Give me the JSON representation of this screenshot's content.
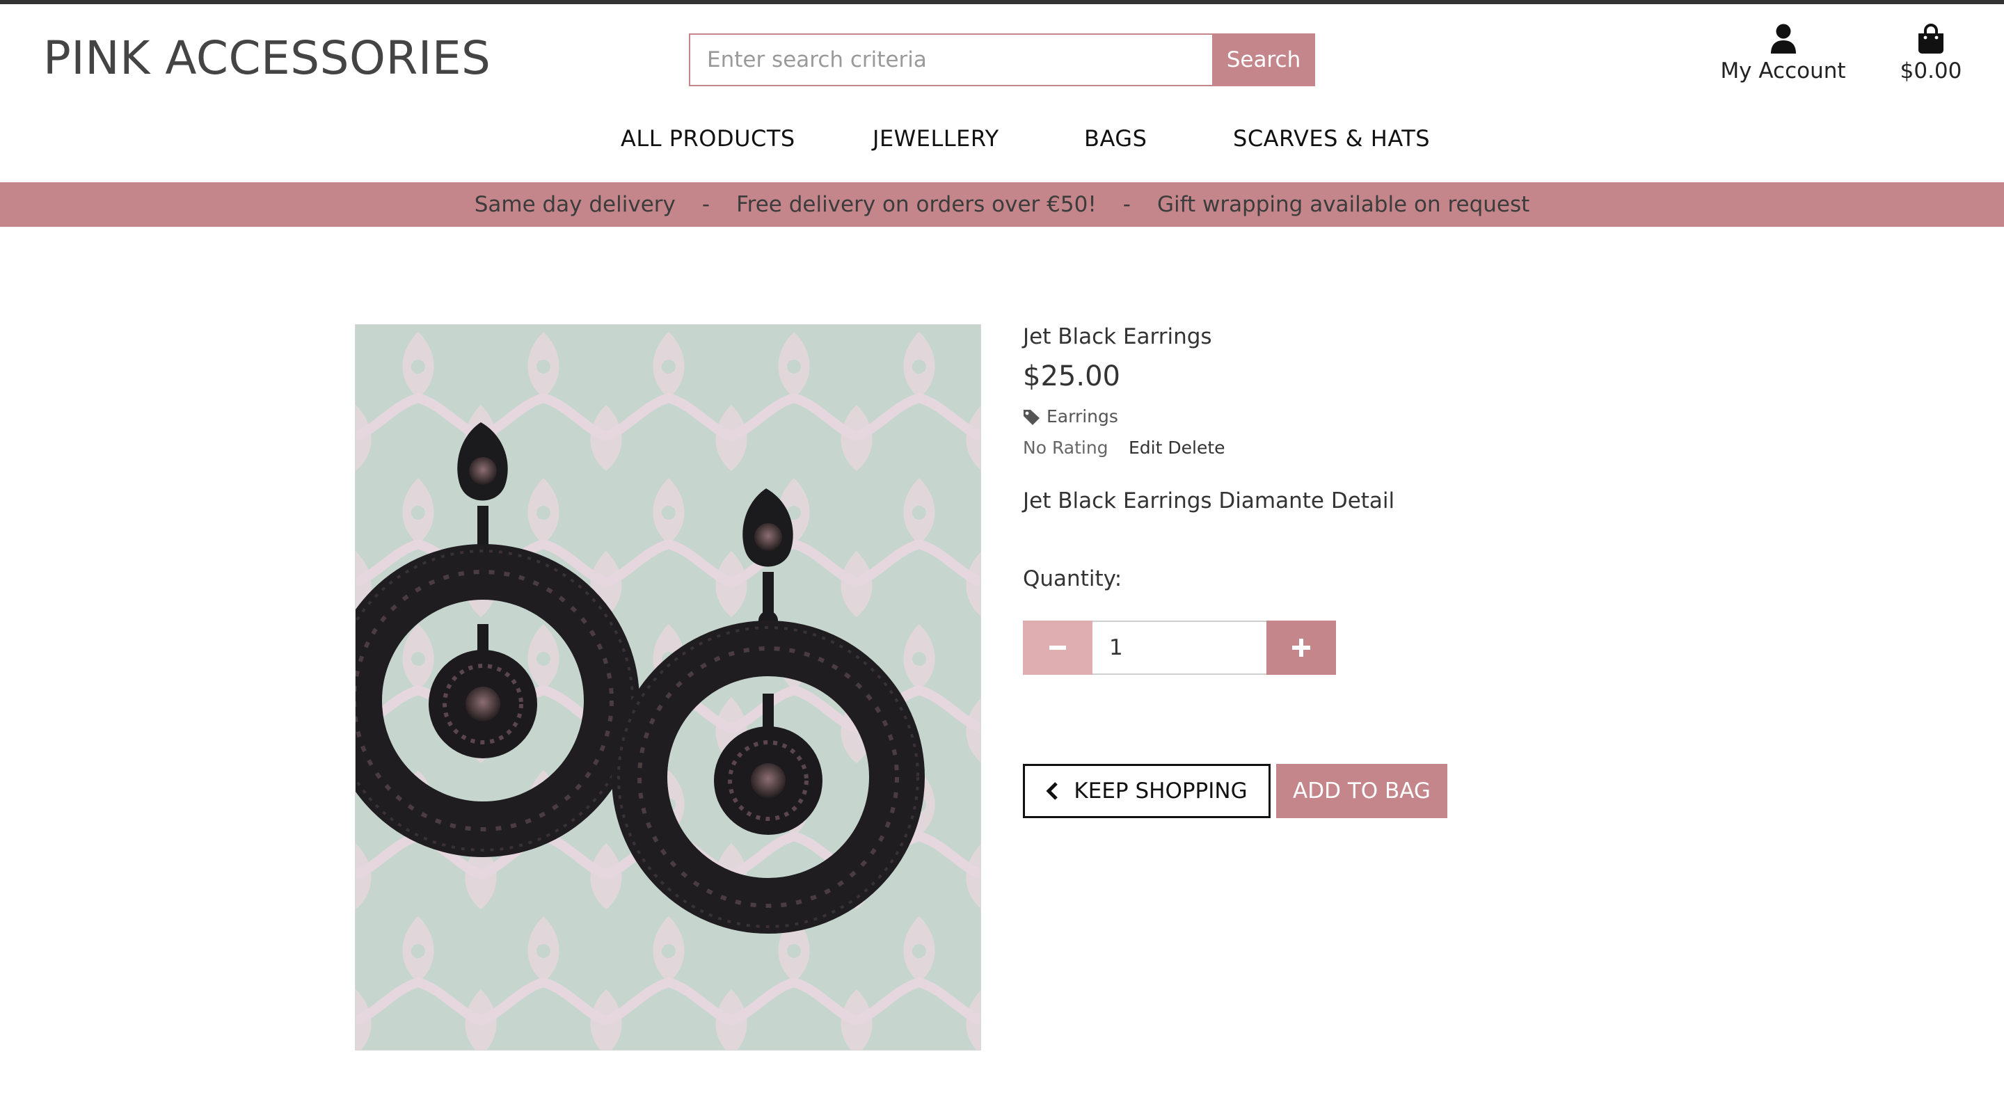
{
  "header": {
    "logo": "PINK ACCESSORIES",
    "search": {
      "placeholder": "Enter search criteria",
      "value": "",
      "button_label": "Search"
    },
    "account": {
      "label": "My Account",
      "icon": "user-icon"
    },
    "bag": {
      "total": "$0.00",
      "icon": "shopping-bag-icon"
    }
  },
  "nav": {
    "items": [
      {
        "label": "ALL PRODUCTS"
      },
      {
        "label": "JEWELLERY"
      },
      {
        "label": "BAGS"
      },
      {
        "label": "SCARVES & HATS"
      }
    ]
  },
  "banner": {
    "messages": [
      "Same day delivery",
      "Free delivery on orders over €50!",
      "Gift wrapping available on request"
    ],
    "separator": "-"
  },
  "product": {
    "image_alt": "Jet Black Earrings",
    "name": "Jet Black Earrings",
    "price": "$25.00",
    "category": "Earrings",
    "category_icon": "tag-icon",
    "rating": "No Rating",
    "edit_label": "Edit",
    "delete_label": "Delete",
    "description": "Jet Black Earrings Diamante Detail",
    "quantity_label": "Quantity:",
    "quantity_value": "1"
  },
  "actions": {
    "keep_shopping": "KEEP SHOPPING",
    "add_to_bag": "ADD TO BAG"
  },
  "colors": {
    "accent": "#c4868a",
    "accent_light": "#dfaeb1",
    "text": "#333333"
  }
}
